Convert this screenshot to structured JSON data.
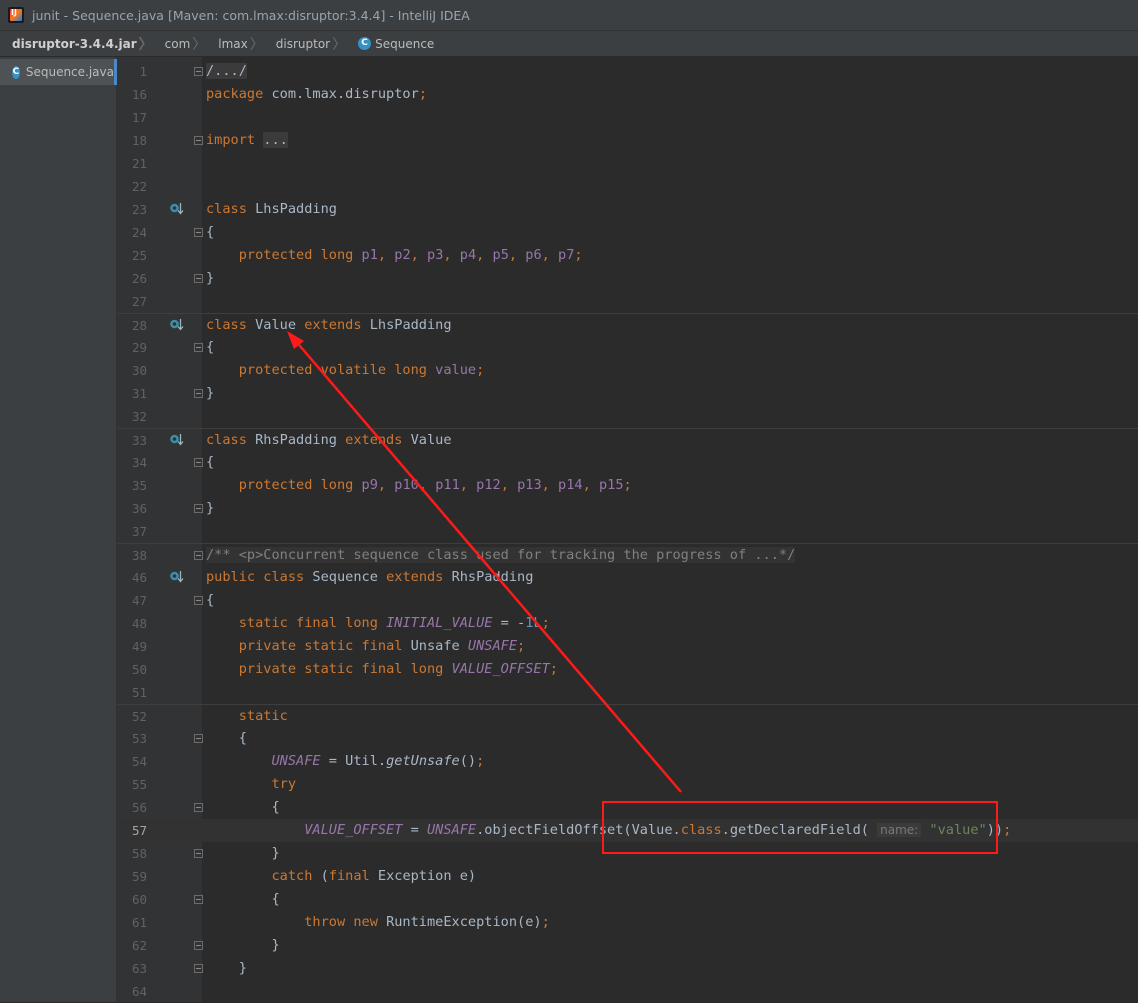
{
  "window": {
    "title": "junit - Sequence.java [Maven: com.lmax:disruptor:3.4.4] - IntelliJ IDEA"
  },
  "breadcrumb": [
    "disruptor-3.4.4.jar",
    "com",
    "lmax",
    "disruptor",
    "Sequence"
  ],
  "project_tab": {
    "label": "Sequence.java"
  },
  "icons": {
    "class_icon": "c-class-icon",
    "override_icon": "implemented-override-icon"
  },
  "colors": {
    "keyword": "#cc7832",
    "field": "#9876aa",
    "string": "#6a8759",
    "number": "#6897bb",
    "comment": "#808080",
    "text": "#a9b7c6",
    "annotation": "#ff1a1a"
  },
  "code_lines": [
    {
      "n": "1",
      "fold": true,
      "tokens": [
        [
          "c",
          "/.../"
        ]
      ]
    },
    {
      "n": "16",
      "tokens": [
        [
          "k",
          "package "
        ],
        [
          "t",
          "com.lmax.disruptor"
        ],
        [
          "k",
          ";"
        ]
      ]
    },
    {
      "n": "17",
      "tokens": []
    },
    {
      "n": "18",
      "fold": true,
      "tokens": [
        [
          "k",
          "import "
        ],
        [
          "c",
          "..."
        ]
      ]
    },
    {
      "n": "21",
      "tokens": []
    },
    {
      "n": "22",
      "tokens": []
    },
    {
      "n": "23",
      "ovr": true,
      "tokens": [
        [
          "k",
          "class "
        ],
        [
          "t",
          "LhsPadding"
        ]
      ]
    },
    {
      "n": "24",
      "fold": true,
      "tokens": [
        [
          "t",
          "{"
        ]
      ]
    },
    {
      "n": "25",
      "tokens": [
        [
          "t",
          "    "
        ],
        [
          "k",
          "protected long "
        ],
        [
          "f",
          "p1"
        ],
        [
          "k",
          ", "
        ],
        [
          "f",
          "p2"
        ],
        [
          "k",
          ", "
        ],
        [
          "f",
          "p3"
        ],
        [
          "k",
          ", "
        ],
        [
          "f",
          "p4"
        ],
        [
          "k",
          ", "
        ],
        [
          "f",
          "p5"
        ],
        [
          "k",
          ", "
        ],
        [
          "f",
          "p6"
        ],
        [
          "k",
          ", "
        ],
        [
          "f",
          "p7"
        ],
        [
          "k",
          ";"
        ]
      ]
    },
    {
      "n": "26",
      "fold": true,
      "tokens": [
        [
          "t",
          "}"
        ]
      ]
    },
    {
      "n": "27",
      "tokens": []
    },
    {
      "n": "28",
      "ovr": true,
      "sep": true,
      "tokens": [
        [
          "k",
          "class "
        ],
        [
          "t",
          "Value "
        ],
        [
          "k",
          "extends "
        ],
        [
          "t",
          "LhsPadding"
        ]
      ]
    },
    {
      "n": "29",
      "fold": true,
      "tokens": [
        [
          "t",
          "{"
        ]
      ]
    },
    {
      "n": "30",
      "tokens": [
        [
          "t",
          "    "
        ],
        [
          "k",
          "protected volatile long "
        ],
        [
          "f",
          "value"
        ],
        [
          "k",
          ";"
        ]
      ]
    },
    {
      "n": "31",
      "fold": true,
      "tokens": [
        [
          "t",
          "}"
        ]
      ]
    },
    {
      "n": "32",
      "tokens": []
    },
    {
      "n": "33",
      "ovr": true,
      "sep": true,
      "tokens": [
        [
          "k",
          "class "
        ],
        [
          "t",
          "RhsPadding "
        ],
        [
          "k",
          "extends "
        ],
        [
          "t",
          "Value"
        ]
      ]
    },
    {
      "n": "34",
      "fold": true,
      "tokens": [
        [
          "t",
          "{"
        ]
      ]
    },
    {
      "n": "35",
      "tokens": [
        [
          "t",
          "    "
        ],
        [
          "k",
          "protected long "
        ],
        [
          "f",
          "p9"
        ],
        [
          "k",
          ", "
        ],
        [
          "f",
          "p10"
        ],
        [
          "k",
          ", "
        ],
        [
          "f",
          "p11"
        ],
        [
          "k",
          ", "
        ],
        [
          "f",
          "p12"
        ],
        [
          "k",
          ", "
        ],
        [
          "f",
          "p13"
        ],
        [
          "k",
          ", "
        ],
        [
          "f",
          "p14"
        ],
        [
          "k",
          ", "
        ],
        [
          "f",
          "p15"
        ],
        [
          "k",
          ";"
        ]
      ]
    },
    {
      "n": "36",
      "fold": true,
      "tokens": [
        [
          "t",
          "}"
        ]
      ]
    },
    {
      "n": "37",
      "tokens": []
    },
    {
      "n": "38",
      "fold": true,
      "sep": true,
      "tokens": [
        [
          "cm",
          "/** <p>Concurrent sequence class used for tracking the progress of ...*/"
        ]
      ]
    },
    {
      "n": "46",
      "ovr": true,
      "tokens": [
        [
          "k",
          "public class "
        ],
        [
          "t",
          "Sequence "
        ],
        [
          "k",
          "extends "
        ],
        [
          "t",
          "RhsPadding"
        ]
      ]
    },
    {
      "n": "47",
      "fold": true,
      "tokens": [
        [
          "t",
          "{"
        ]
      ]
    },
    {
      "n": "48",
      "tokens": [
        [
          "t",
          "    "
        ],
        [
          "k",
          "static final long "
        ],
        [
          "fi",
          "INITIAL_VALUE"
        ],
        [
          "t",
          " = -"
        ],
        [
          "num",
          "1L"
        ],
        [
          "k",
          ";"
        ]
      ]
    },
    {
      "n": "49",
      "tokens": [
        [
          "t",
          "    "
        ],
        [
          "k",
          "private static final "
        ],
        [
          "t",
          "Unsafe "
        ],
        [
          "fi",
          "UNSAFE"
        ],
        [
          "k",
          ";"
        ]
      ]
    },
    {
      "n": "50",
      "tokens": [
        [
          "t",
          "    "
        ],
        [
          "k",
          "private static final long "
        ],
        [
          "fi",
          "VALUE_OFFSET"
        ],
        [
          "k",
          ";"
        ]
      ]
    },
    {
      "n": "51",
      "tokens": []
    },
    {
      "n": "52",
      "sep": true,
      "tokens": [
        [
          "t",
          "    "
        ],
        [
          "k",
          "static"
        ]
      ]
    },
    {
      "n": "53",
      "fold": true,
      "tokens": [
        [
          "t",
          "    {"
        ]
      ]
    },
    {
      "n": "54",
      "tokens": [
        [
          "t",
          "        "
        ],
        [
          "fi",
          "UNSAFE"
        ],
        [
          "t",
          " = Util."
        ],
        [
          "mi",
          "getUnsafe"
        ],
        [
          "t",
          "()"
        ],
        [
          "k",
          ";"
        ]
      ]
    },
    {
      "n": "55",
      "tokens": [
        [
          "t",
          "        "
        ],
        [
          "k",
          "try"
        ]
      ]
    },
    {
      "n": "56",
      "fold": true,
      "tokens": [
        [
          "t",
          "        {"
        ]
      ]
    },
    {
      "n": "57",
      "current": true,
      "tokens": [
        [
          "t",
          "            "
        ],
        [
          "fi",
          "VALUE_OFFSET"
        ],
        [
          "t",
          " = "
        ],
        [
          "fi",
          "UNSAFE"
        ],
        [
          "t",
          ".objectFieldOffset(Value."
        ],
        [
          "k",
          "class"
        ],
        [
          "t",
          ".getDeclaredField( "
        ],
        [
          "hint",
          "name:"
        ],
        [
          "t",
          " "
        ],
        [
          "s",
          "\"value\""
        ],
        [
          "t",
          "))"
        ],
        [
          "k",
          ";"
        ]
      ]
    },
    {
      "n": "58",
      "fold": true,
      "tokens": [
        [
          "t",
          "        }"
        ]
      ]
    },
    {
      "n": "59",
      "tokens": [
        [
          "t",
          "        "
        ],
        [
          "k",
          "catch "
        ],
        [
          "t",
          "("
        ],
        [
          "k",
          "final "
        ],
        [
          "t",
          "Exception e)"
        ]
      ]
    },
    {
      "n": "60",
      "fold": true,
      "tokens": [
        [
          "t",
          "        {"
        ]
      ]
    },
    {
      "n": "61",
      "tokens": [
        [
          "t",
          "            "
        ],
        [
          "k",
          "throw new "
        ],
        [
          "t",
          "RuntimeException(e)"
        ],
        [
          "k",
          ";"
        ]
      ]
    },
    {
      "n": "62",
      "fold": true,
      "tokens": [
        [
          "t",
          "        }"
        ]
      ]
    },
    {
      "n": "63",
      "fold": true,
      "tokens": [
        [
          "t",
          "    }"
        ]
      ]
    },
    {
      "n": "64",
      "tokens": []
    }
  ]
}
